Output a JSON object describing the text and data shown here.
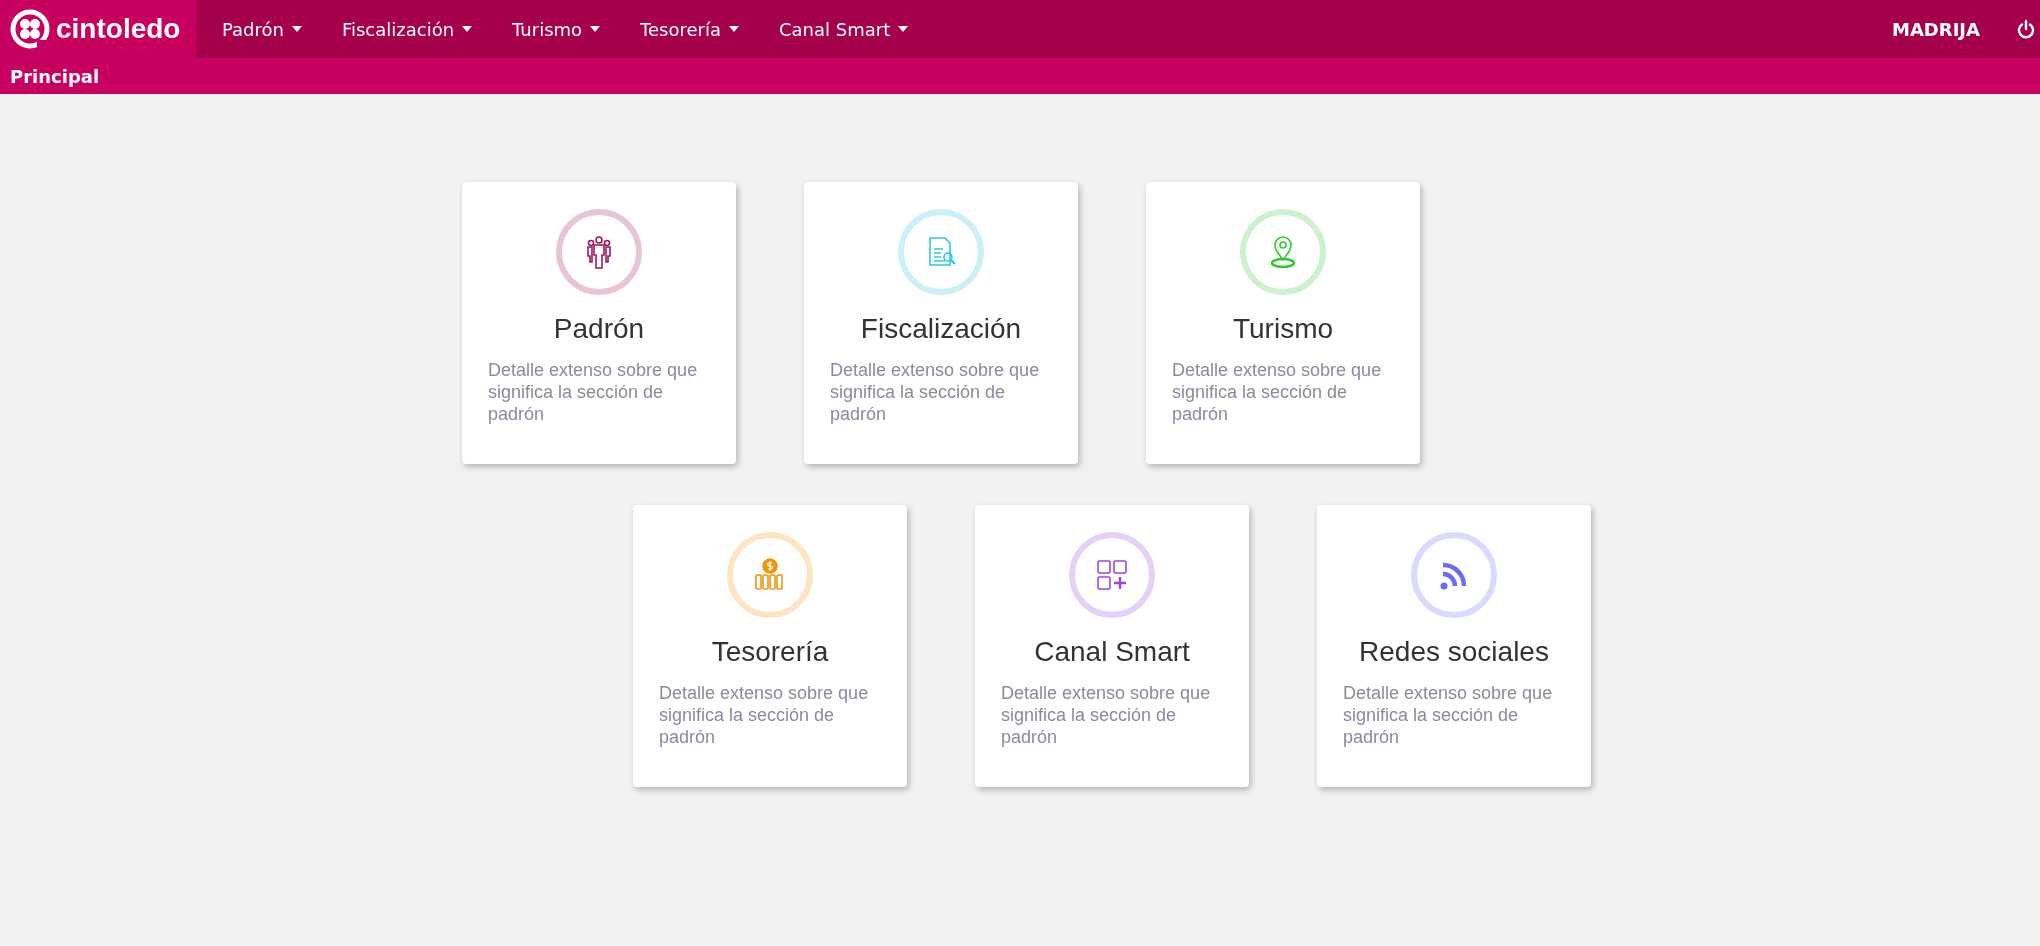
{
  "brand": {
    "name": "cintoledo"
  },
  "nav": [
    {
      "label": "Padrón"
    },
    {
      "label": "Fiscalización"
    },
    {
      "label": "Turismo"
    },
    {
      "label": "Tesorería"
    },
    {
      "label": "Canal Smart"
    }
  ],
  "user": "MADRIJA",
  "breadcrumb": "Principal",
  "cards": [
    {
      "title": "Padrón",
      "description": "Detalle extenso sobre que significa la sección de padrón",
      "kind": "people",
      "color": "#a0185a"
    },
    {
      "title": "Fiscalización",
      "description": "Detalle extenso sobre que significa la sección de padrón",
      "kind": "document",
      "color": "#2ec9e0"
    },
    {
      "title": "Turismo",
      "description": "Detalle extenso sobre que significa la sección de padrón",
      "kind": "location",
      "color": "#34c934"
    },
    {
      "title": "Tesorería",
      "description": "Detalle extenso sobre que significa la sección de padrón",
      "kind": "money",
      "color": "#f0960a"
    },
    {
      "title": "Canal Smart",
      "description": "Detalle extenso sobre que significa la sección de padrón",
      "kind": "apps",
      "color": "#9b45e0"
    },
    {
      "title": "Redes sociales",
      "description": "Detalle extenso sobre que significa la sección de padrón",
      "kind": "feed",
      "color": "#6c6cf5"
    }
  ]
}
